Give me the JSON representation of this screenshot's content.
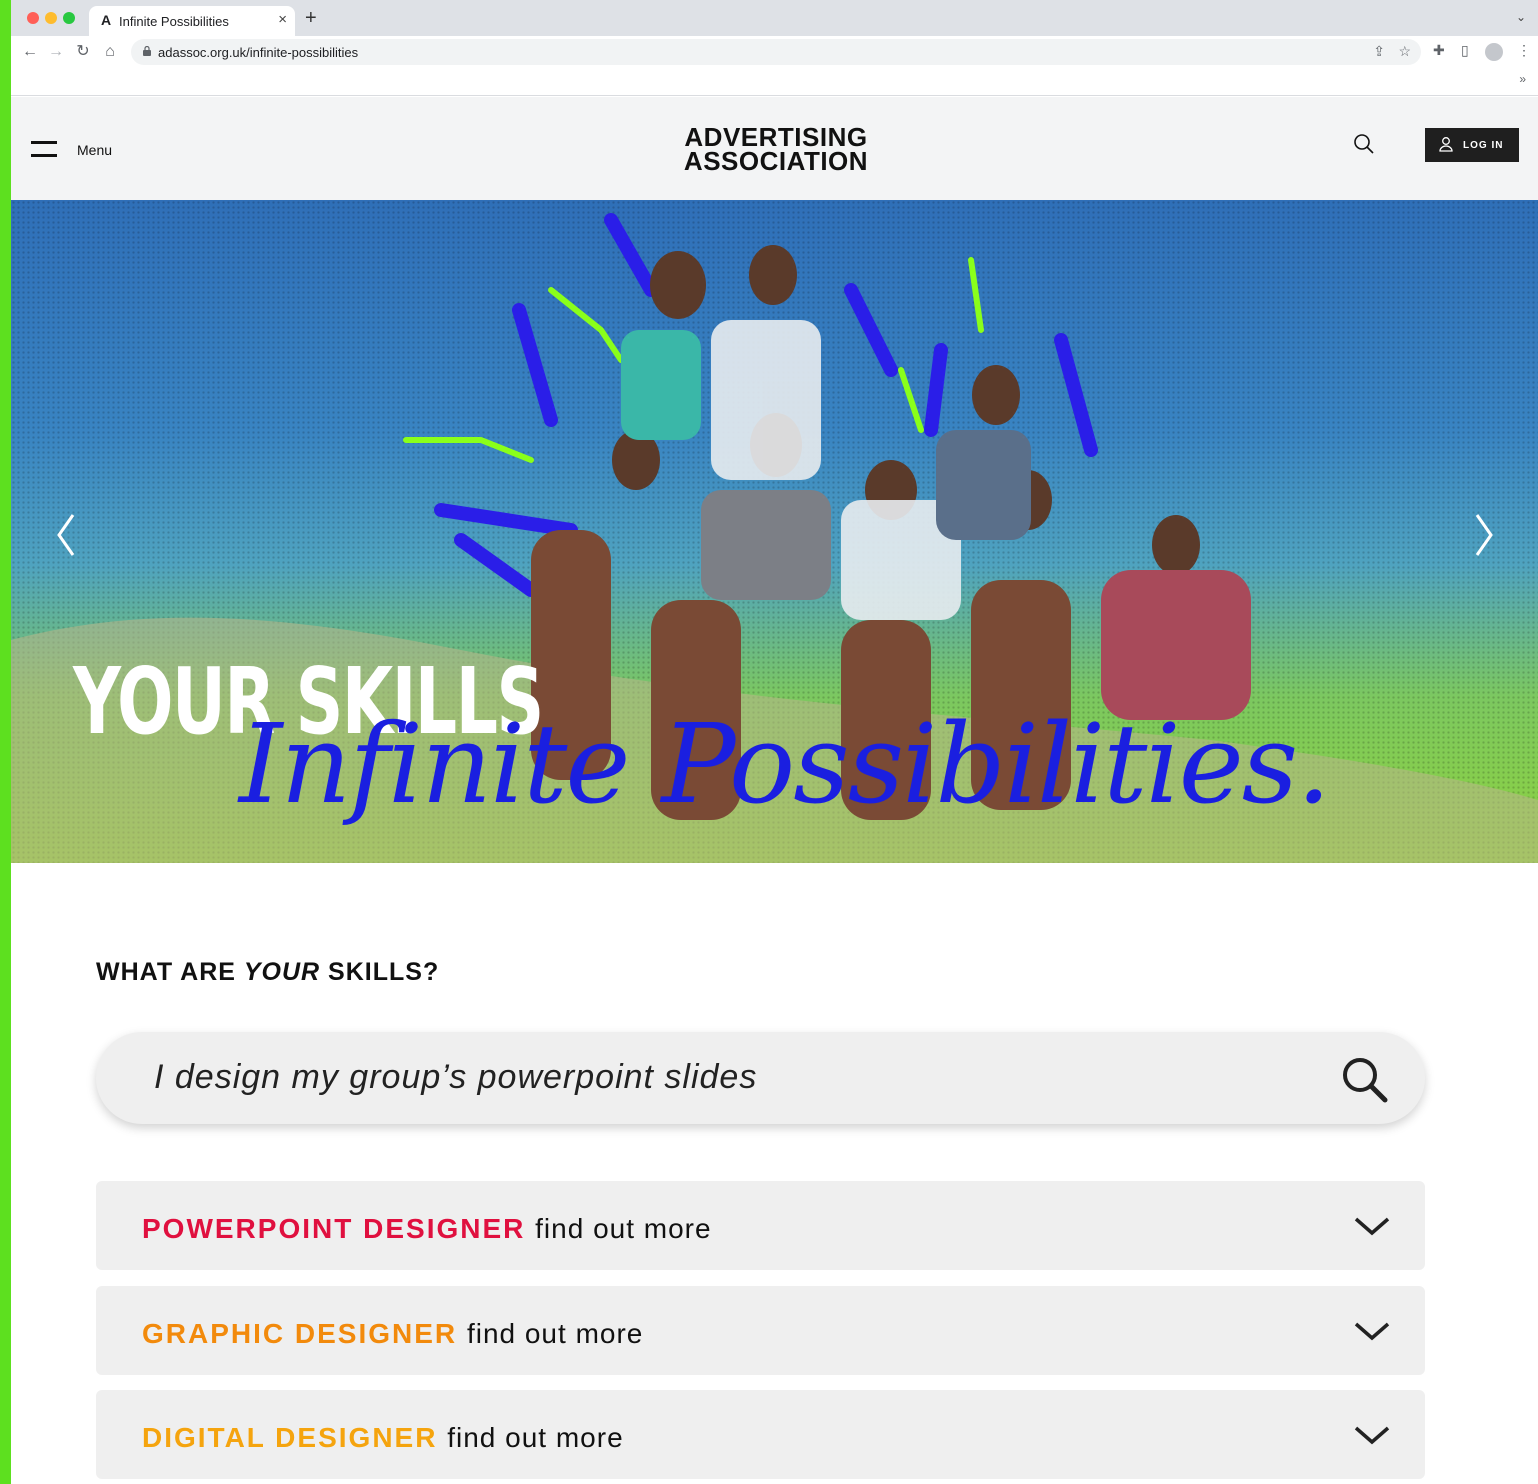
{
  "browser": {
    "tab_title": "Infinite Possibilities",
    "tab_favicon": "A",
    "url": "adassoc.org.uk/infinite-possibilities",
    "bookmarks_more": "»"
  },
  "site": {
    "menu_label": "Menu",
    "logo_line1": "ADVERTISING",
    "logo_line2": "ASSOCIATION",
    "login_label": "LOG IN"
  },
  "hero": {
    "headline": "YOUR SKILLS",
    "script": "Infinite Possibilities."
  },
  "skills": {
    "heading_pre": "WHAT ARE ",
    "heading_em": "YOUR",
    "heading_post": " SKILLS?",
    "search_value": "I design my group’s powerpoint slides"
  },
  "careers": [
    {
      "title": "POWERPOINT DESIGNER",
      "more": "find out more",
      "color": "#e0103f"
    },
    {
      "title": "GRAPHIC DESIGNER",
      "more": "find out more",
      "color": "#f28a0c"
    },
    {
      "title": "DIGITAL DESIGNER",
      "more": "find out more",
      "color": "#f5a40e"
    }
  ],
  "colors": {
    "page_border": "#5de01f",
    "hero_script": "#1a1fe0",
    "login_bg": "#1f1f1f"
  }
}
